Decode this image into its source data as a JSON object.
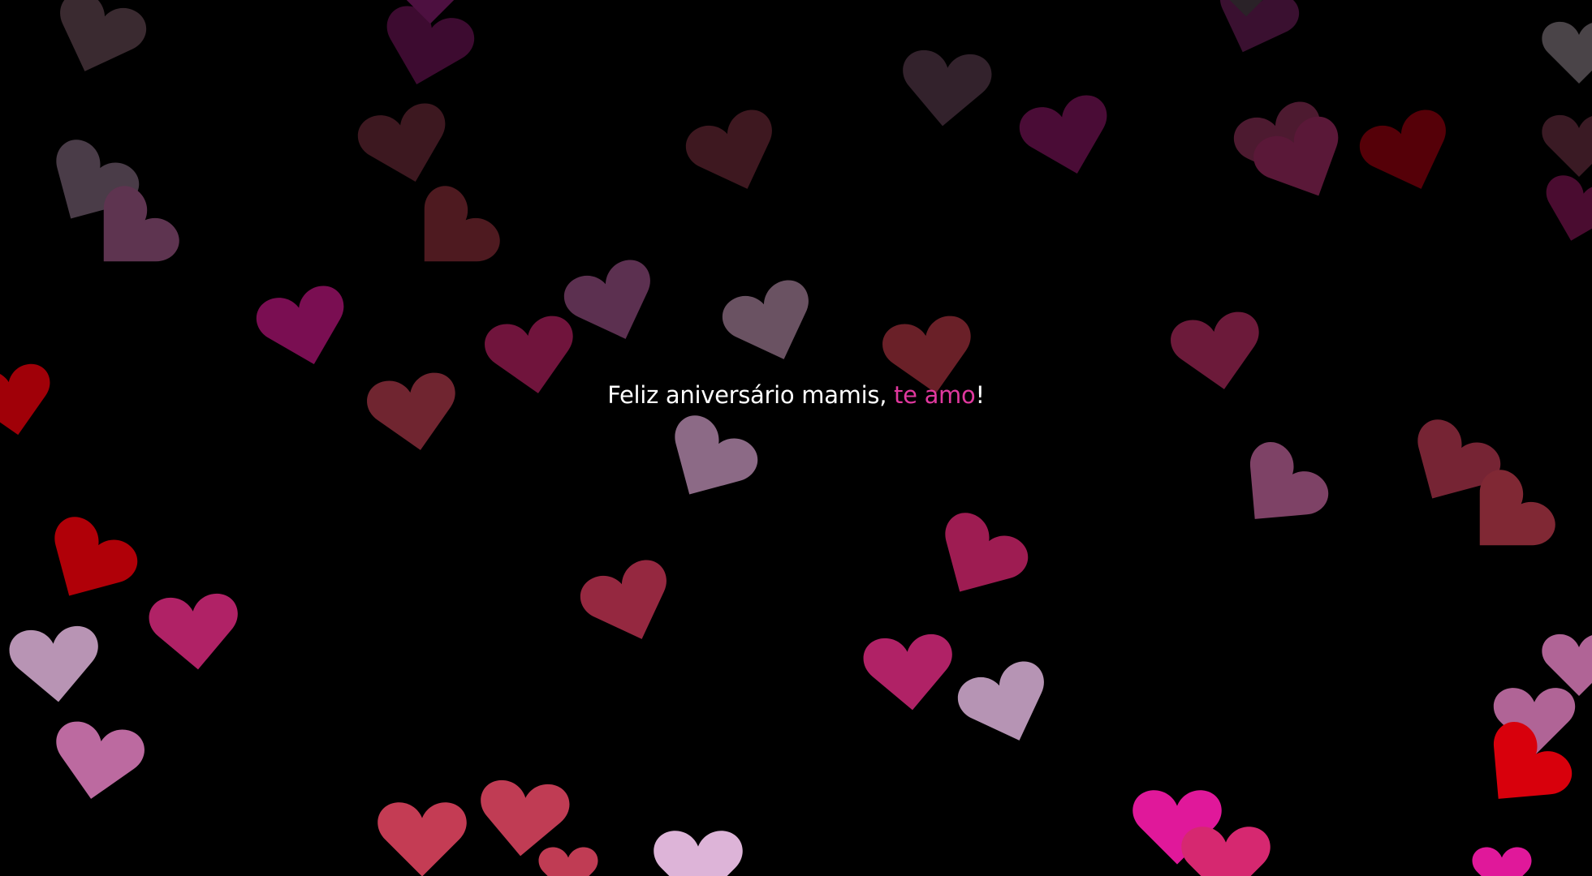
{
  "message": {
    "main": "Feliz aniversário mamis, ",
    "highlight": "te amo",
    "end": "!"
  },
  "colors": {
    "background": "#000000",
    "text": "#ffffff",
    "highlight": "#e0389e"
  },
  "decor_icon": "heart-icon"
}
